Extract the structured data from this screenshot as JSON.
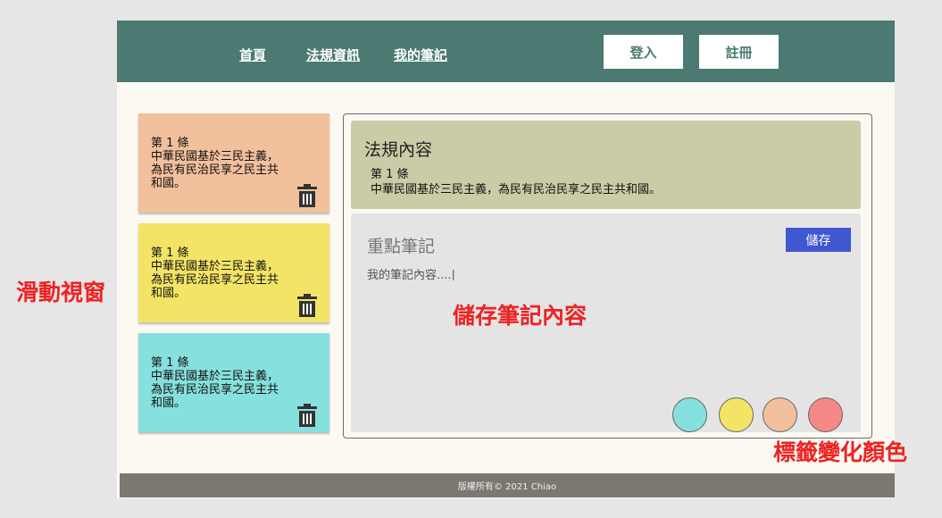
{
  "nav": {
    "links": [
      "首頁",
      "法規資訊",
      "我的筆記"
    ],
    "login_label": "登入",
    "register_label": "註冊"
  },
  "notes": [
    {
      "title": "第 1 條",
      "body": "中華民國基於三民主義，為民有民治民享之民主共和國。",
      "color": "#f2c09d"
    },
    {
      "title": "第 1 條",
      "body": "中華民國基於三民主義，為民有民治民享之民主共和國。",
      "color": "#f4e466"
    },
    {
      "title": "第 1 條",
      "body": "中華民國基於三民主義，為民有民治民享之民主共和國。",
      "color": "#86e0dd"
    }
  ],
  "law": {
    "heading": "法規內容",
    "article_title": "第 1 條",
    "article_body": "中華民國基於三民主義，為民有民治民享之民主共和國。"
  },
  "editor": {
    "heading": "重點筆記",
    "note_value": "我的筆記內容....|",
    "save_label": "儲存"
  },
  "tag_colors": [
    "#86e0dd",
    "#f4e466",
    "#f2c09d",
    "#f68787"
  ],
  "footer": {
    "text": "版權所有© 2021 Chiao"
  },
  "annotations": {
    "scroll_window": "滑動視窗",
    "save_note": "儲存筆記內容",
    "tag_color": "標籤變化顏色"
  }
}
